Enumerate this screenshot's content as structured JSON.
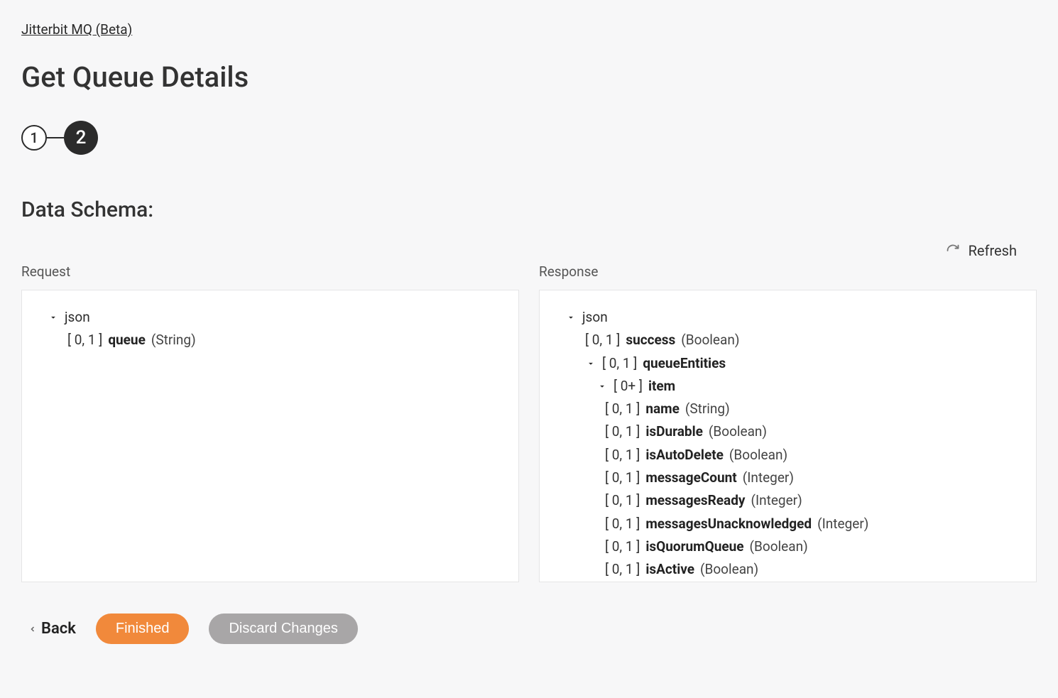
{
  "breadcrumb": {
    "label": "Jitterbit MQ (Beta)"
  },
  "page": {
    "title": "Get Queue Details"
  },
  "stepper": {
    "steps": [
      "1",
      "2"
    ],
    "active_index": 1
  },
  "section": {
    "heading": "Data Schema:"
  },
  "refresh": {
    "label": "Refresh"
  },
  "columns": {
    "request": {
      "label": "Request"
    },
    "response": {
      "label": "Response"
    }
  },
  "schema": {
    "request": {
      "root": "json",
      "fields": [
        {
          "card": "[ 0, 1 ]",
          "name": "queue",
          "type": "(String)"
        }
      ]
    },
    "response": {
      "root": "json",
      "success": {
        "card": "[ 0, 1 ]",
        "name": "success",
        "type": "(Boolean)"
      },
      "queueEntities": {
        "card": "[ 0, 1 ]",
        "name": "queueEntities"
      },
      "item": {
        "card": "[ 0+ ]",
        "name": "item"
      },
      "item_fields": [
        {
          "card": "[ 0, 1 ]",
          "name": "name",
          "type": "(String)"
        },
        {
          "card": "[ 0, 1 ]",
          "name": "isDurable",
          "type": "(Boolean)"
        },
        {
          "card": "[ 0, 1 ]",
          "name": "isAutoDelete",
          "type": "(Boolean)"
        },
        {
          "card": "[ 0, 1 ]",
          "name": "messageCount",
          "type": "(Integer)"
        },
        {
          "card": "[ 0, 1 ]",
          "name": "messagesReady",
          "type": "(Integer)"
        },
        {
          "card": "[ 0, 1 ]",
          "name": "messagesUnacknowledged",
          "type": "(Integer)"
        },
        {
          "card": "[ 0, 1 ]",
          "name": "isQuorumQueue",
          "type": "(Boolean)"
        },
        {
          "card": "[ 0, 1 ]",
          "name": "isActive",
          "type": "(Boolean)"
        }
      ]
    }
  },
  "footer": {
    "back": "Back",
    "finished": "Finished",
    "discard": "Discard Changes"
  }
}
